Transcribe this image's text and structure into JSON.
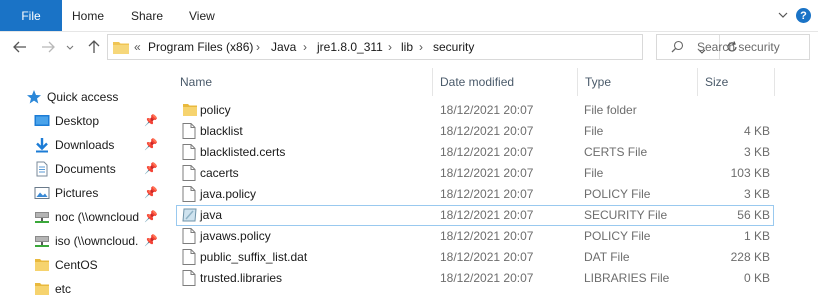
{
  "ribbon": {
    "tabs": [
      {
        "label": "File"
      },
      {
        "label": "Home"
      },
      {
        "label": "Share"
      },
      {
        "label": "View"
      }
    ],
    "accent": "#1a73c6"
  },
  "nav": {
    "breadcrumb": [
      "Program Files (x86)",
      "Java",
      "jre1.8.0_311",
      "lib",
      "security"
    ],
    "overflow": "«",
    "search_placeholder": "Search security"
  },
  "sidebar": {
    "items": [
      {
        "label": "Quick access",
        "icon": "star-icon",
        "pinned": false
      },
      {
        "label": "Desktop",
        "icon": "desktop-icon",
        "pinned": true
      },
      {
        "label": "Downloads",
        "icon": "downloads-icon",
        "pinned": true
      },
      {
        "label": "Documents",
        "icon": "documents-icon",
        "pinned": true
      },
      {
        "label": "Pictures",
        "icon": "pictures-icon",
        "pinned": true
      },
      {
        "label": "noc (\\\\owncloud",
        "icon": "network-drive-icon",
        "pinned": true
      },
      {
        "label": "iso (\\\\owncloud.",
        "icon": "network-drive-icon",
        "pinned": true
      },
      {
        "label": "CentOS",
        "icon": "folder-icon",
        "pinned": false
      },
      {
        "label": "etc",
        "icon": "folder-icon",
        "pinned": false
      }
    ]
  },
  "columns": {
    "name": "Name",
    "date": "Date modified",
    "type": "Type",
    "size": "Size"
  },
  "files": [
    {
      "name": "policy",
      "date": "18/12/2021 20:07",
      "type": "File folder",
      "size": "",
      "icon": "folder-icon"
    },
    {
      "name": "blacklist",
      "date": "18/12/2021 20:07",
      "type": "File",
      "size": "4 KB",
      "icon": "file-icon"
    },
    {
      "name": "blacklisted.certs",
      "date": "18/12/2021 20:07",
      "type": "CERTS File",
      "size": "3 KB",
      "icon": "file-icon"
    },
    {
      "name": "cacerts",
      "date": "18/12/2021 20:07",
      "type": "File",
      "size": "103 KB",
      "icon": "file-icon"
    },
    {
      "name": "java.policy",
      "date": "18/12/2021 20:07",
      "type": "POLICY File",
      "size": "3 KB",
      "icon": "file-icon"
    },
    {
      "name": "java",
      "date": "18/12/2021 20:07",
      "type": "SECURITY File",
      "size": "56 KB",
      "icon": "security-file-icon"
    },
    {
      "name": "javaws.policy",
      "date": "18/12/2021 20:07",
      "type": "POLICY File",
      "size": "1 KB",
      "icon": "file-icon"
    },
    {
      "name": "public_suffix_list.dat",
      "date": "18/12/2021 20:07",
      "type": "DAT File",
      "size": "228 KB",
      "icon": "file-icon"
    },
    {
      "name": "trusted.libraries",
      "date": "18/12/2021 20:07",
      "type": "LIBRARIES File",
      "size": "0 KB",
      "icon": "file-icon"
    }
  ],
  "selected_file": "java"
}
